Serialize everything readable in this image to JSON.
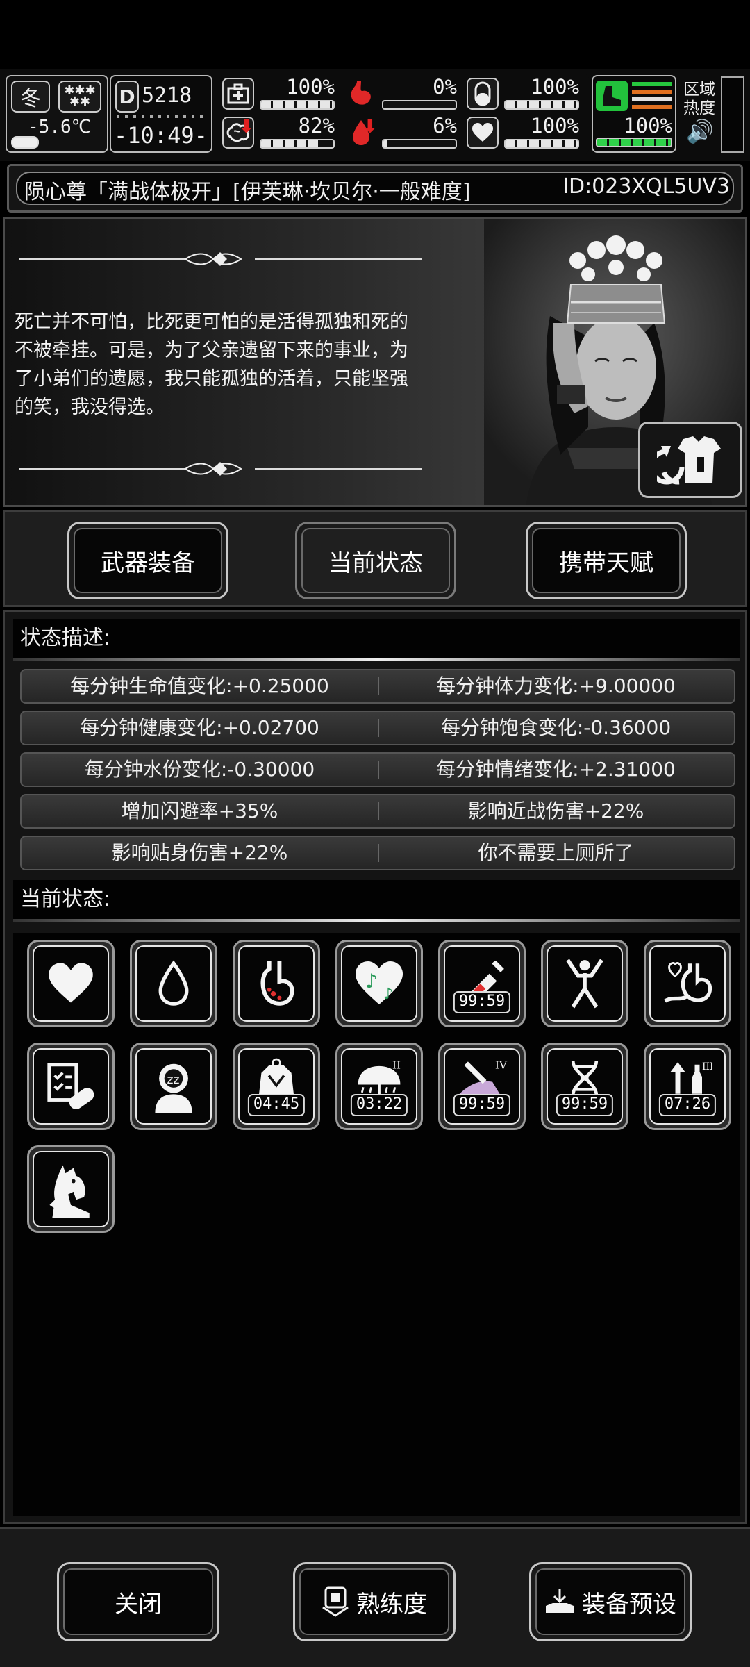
{
  "hud": {
    "season": "冬",
    "weather_icon": "snowflake-stars-icon",
    "temperature": "-5.6℃",
    "day_label": "D",
    "day_number": "5218",
    "clock": "-10:49-",
    "stats": [
      {
        "name": "health-kit",
        "percent": "100%",
        "level": 1.0
      },
      {
        "name": "stomach",
        "percent": "0%",
        "level": 0.0
      },
      {
        "name": "capsule",
        "percent": "100%",
        "level": 1.0
      },
      {
        "name": "brain",
        "percent": "82%",
        "level": 0.82,
        "falling": true
      },
      {
        "name": "water-drop",
        "percent": "6%",
        "level": 0.06,
        "falling": true
      },
      {
        "name": "heart",
        "percent": "100%",
        "level": 1.0
      }
    ],
    "stamina_percent": "100%",
    "stamina_level": 1.0,
    "zone_heat_label": "区域热度",
    "sound_icon": "speaker-icon"
  },
  "title": {
    "text": "陨心尊「满战体极开」[伊芙琳·坎贝尔·一般难度]",
    "id": "ID:023XQL5UV3"
  },
  "story": {
    "text": "死亡并不可怕，比死更可怕的是活得孤独和死的不被牵挂。可是，为了父亲遗留下来的事业，为了小弟们的遗愿，我只能孤独的活着，只能坚强的笑，我没得选。"
  },
  "tabs": [
    {
      "label": "武器装备",
      "active": false
    },
    {
      "label": "当前状态",
      "active": true
    },
    {
      "label": "携带天赋",
      "active": false
    }
  ],
  "status": {
    "description_header": "状态描述:",
    "rows": [
      [
        "每分钟生命值变化:+0.25000",
        "每分钟体力变化:+9.00000"
      ],
      [
        "每分钟健康变化:+0.02700",
        "每分钟饱食变化:-0.36000"
      ],
      [
        "每分钟水份变化:-0.30000",
        "每分钟情绪变化:+2.31000"
      ],
      [
        "增加闪避率+35%",
        "影响近战伤害+22%"
      ],
      [
        "影响贴身伤害+22%",
        "你不需要上厕所了"
      ]
    ],
    "current_header": "当前状态:",
    "effects": [
      {
        "icon": "heart-icon",
        "timer": ""
      },
      {
        "icon": "water-drop-icon",
        "timer": ""
      },
      {
        "icon": "stomach-icon",
        "timer": ""
      },
      {
        "icon": "music-heart-icon",
        "timer": ""
      },
      {
        "icon": "syringe-icon",
        "timer": "99:59"
      },
      {
        "icon": "stretching-person-icon",
        "timer": ""
      },
      {
        "icon": "heart-stomach-icon",
        "timer": ""
      },
      {
        "icon": "medical-checklist-pill-icon",
        "timer": ""
      },
      {
        "icon": "sleeping-head-icon",
        "timer": ""
      },
      {
        "icon": "wounded-body-icon",
        "timer": "04:45"
      },
      {
        "icon": "umbrella-rain-icon",
        "timer": "03:22"
      },
      {
        "icon": "injection-arm-icon",
        "timer": "99:59"
      },
      {
        "icon": "dna-icon",
        "timer": "99:59"
      },
      {
        "icon": "bottle-boost-icon",
        "timer": "07:26"
      },
      {
        "icon": "horse-head-icon",
        "timer": ""
      }
    ]
  },
  "bottom": {
    "close_label": "关闭",
    "proficiency_label": "熟练度",
    "preset_label": "装备预设"
  }
}
